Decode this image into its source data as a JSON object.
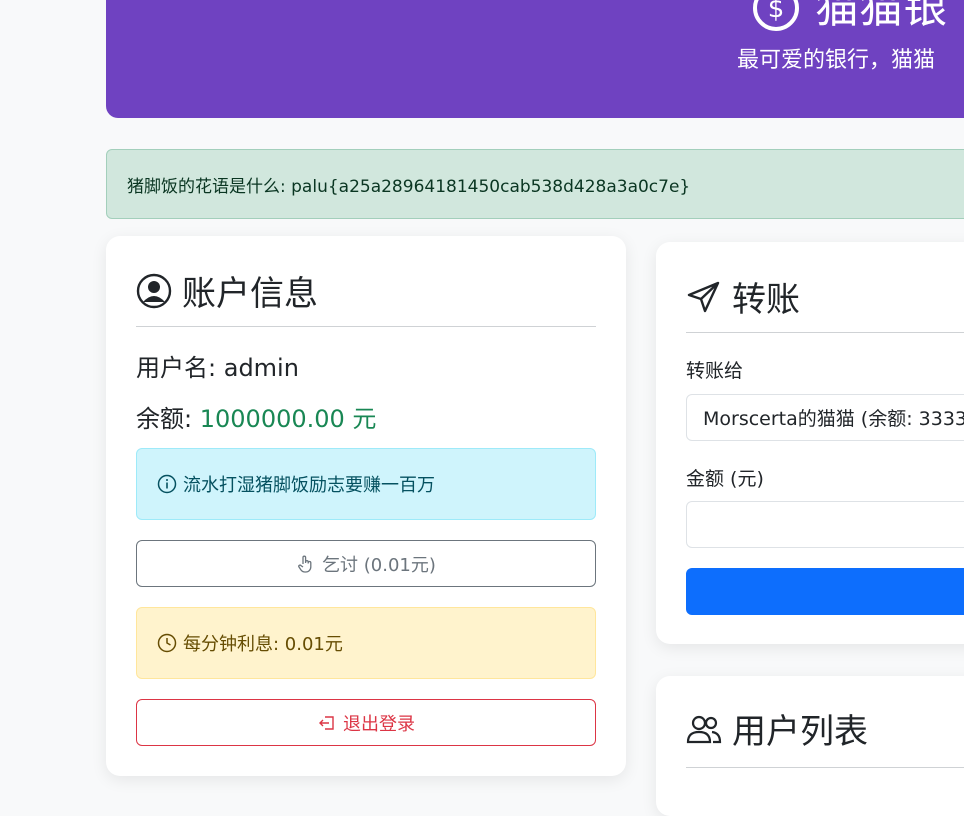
{
  "header": {
    "title": "猫猫银",
    "subtitle": "最可爱的银行，猫猫"
  },
  "flag_alert": {
    "text": "猪脚饭的花语是什么: palu{a25a28964181450cab538d428a3a0c7e}"
  },
  "account": {
    "title": "账户信息",
    "username_label": "用户名:",
    "username": "admin",
    "balance_label": "余额:",
    "balance": "1000000.00 元",
    "info_text": "流水打湿猪脚饭励志要赚一百万",
    "beg_button": "乞讨 (0.01元)",
    "interest_text": "每分钟利息: 0.01元",
    "logout_button": "退出登录"
  },
  "transfer": {
    "title": "转账",
    "to_label": "转账给",
    "to_selected": "Morscerta的猫猫 (余额: 3333",
    "amount_label": "金额 (元)",
    "amount_value": ""
  },
  "users": {
    "title": "用户列表"
  },
  "colors": {
    "hero": "#6f42c1",
    "balance": "#198754",
    "primary": "#0d6efd",
    "danger": "#dc3545"
  }
}
